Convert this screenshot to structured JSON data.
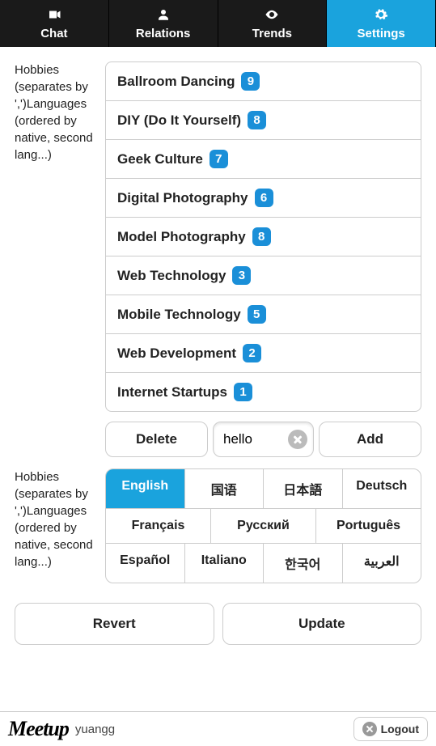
{
  "nav": {
    "tabs": [
      {
        "label": "Chat",
        "icon": "video-icon"
      },
      {
        "label": "Relations",
        "icon": "person-icon"
      },
      {
        "label": "Trends",
        "icon": "eye-icon"
      },
      {
        "label": "Settings",
        "icon": "gear-icon",
        "active": true
      }
    ]
  },
  "sections": {
    "hobbies_label": "Hobbies (separates by ',')Languages (ordered by native, second lang...)",
    "languages_label": "Hobbies (separates by ',')Languages (ordered by native, second lang...)"
  },
  "chips": [
    {
      "text": "Ballroom Dancing",
      "n": "9"
    },
    {
      "text": "DIY (Do It Yourself)",
      "n": "8"
    },
    {
      "text": "Geek Culture",
      "n": "7"
    },
    {
      "text": "Digital Photography",
      "n": "6"
    },
    {
      "text": "Model Photography",
      "n": "8"
    },
    {
      "text": "Web Technology",
      "n": "3"
    },
    {
      "text": "Mobile Technology",
      "n": "5"
    },
    {
      "text": "Web Development",
      "n": "2"
    },
    {
      "text": "Internet Startups",
      "n": "1"
    }
  ],
  "toolbar": {
    "delete": "Delete",
    "add": "Add",
    "input_value": "hello"
  },
  "languages": {
    "rows": [
      [
        "English",
        "国语",
        "日本語",
        "Deutsch"
      ],
      [
        "Français",
        "Русский",
        "Português"
      ],
      [
        "Español",
        "Italiano",
        "한국어",
        "العربية"
      ]
    ],
    "selected": "English"
  },
  "actions": {
    "revert": "Revert",
    "update": "Update"
  },
  "footer": {
    "brand": "Meetup",
    "user": "yuangg",
    "logout": "Logout"
  }
}
